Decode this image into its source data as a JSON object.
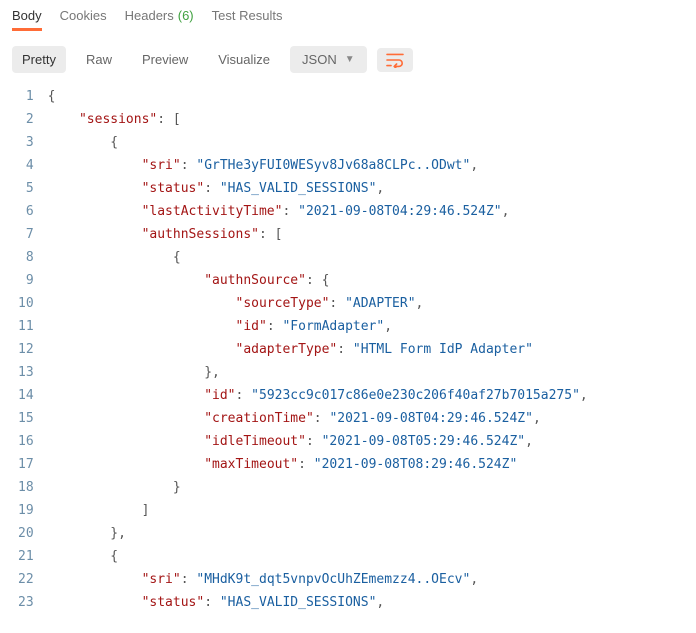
{
  "tabs": {
    "body": "Body",
    "cookies": "Cookies",
    "headers_label": "Headers",
    "headers_count": "(6)",
    "test_results": "Test Results"
  },
  "toolbar": {
    "pretty": "Pretty",
    "raw": "Raw",
    "preview": "Preview",
    "visualize": "Visualize",
    "format_label": "JSON"
  },
  "code": {
    "total_lines": 23,
    "lines": [
      {
        "indent": 0,
        "tokens": [
          {
            "t": "{",
            "c": "punc"
          }
        ]
      },
      {
        "indent": 1,
        "tokens": [
          {
            "t": "\"sessions\"",
            "c": "key"
          },
          {
            "t": ": [",
            "c": "punc"
          }
        ]
      },
      {
        "indent": 2,
        "tokens": [
          {
            "t": "{",
            "c": "punc"
          }
        ]
      },
      {
        "indent": 3,
        "tokens": [
          {
            "t": "\"sri\"",
            "c": "key"
          },
          {
            "t": ": ",
            "c": "punc"
          },
          {
            "t": "\"GrTHe3yFUI0WESyv8Jv68a8CLPc..ODwt\"",
            "c": "str"
          },
          {
            "t": ",",
            "c": "punc"
          }
        ]
      },
      {
        "indent": 3,
        "tokens": [
          {
            "t": "\"status\"",
            "c": "key"
          },
          {
            "t": ": ",
            "c": "punc"
          },
          {
            "t": "\"HAS_VALID_SESSIONS\"",
            "c": "str"
          },
          {
            "t": ",",
            "c": "punc"
          }
        ]
      },
      {
        "indent": 3,
        "tokens": [
          {
            "t": "\"lastActivityTime\"",
            "c": "key"
          },
          {
            "t": ": ",
            "c": "punc"
          },
          {
            "t": "\"2021-09-08T04:29:46.524Z\"",
            "c": "str"
          },
          {
            "t": ",",
            "c": "punc"
          }
        ]
      },
      {
        "indent": 3,
        "tokens": [
          {
            "t": "\"authnSessions\"",
            "c": "key"
          },
          {
            "t": ": [",
            "c": "punc"
          }
        ]
      },
      {
        "indent": 4,
        "tokens": [
          {
            "t": "{",
            "c": "punc"
          }
        ]
      },
      {
        "indent": 5,
        "tokens": [
          {
            "t": "\"authnSource\"",
            "c": "key"
          },
          {
            "t": ": {",
            "c": "punc"
          }
        ]
      },
      {
        "indent": 6,
        "tokens": [
          {
            "t": "\"sourceType\"",
            "c": "key"
          },
          {
            "t": ": ",
            "c": "punc"
          },
          {
            "t": "\"ADAPTER\"",
            "c": "str"
          },
          {
            "t": ",",
            "c": "punc"
          }
        ]
      },
      {
        "indent": 6,
        "tokens": [
          {
            "t": "\"id\"",
            "c": "key"
          },
          {
            "t": ": ",
            "c": "punc"
          },
          {
            "t": "\"FormAdapter\"",
            "c": "str"
          },
          {
            "t": ",",
            "c": "punc"
          }
        ]
      },
      {
        "indent": 6,
        "tokens": [
          {
            "t": "\"adapterType\"",
            "c": "key"
          },
          {
            "t": ": ",
            "c": "punc"
          },
          {
            "t": "\"HTML Form IdP Adapter\"",
            "c": "str"
          }
        ]
      },
      {
        "indent": 5,
        "tokens": [
          {
            "t": "},",
            "c": "punc"
          }
        ]
      },
      {
        "indent": 5,
        "tokens": [
          {
            "t": "\"id\"",
            "c": "key"
          },
          {
            "t": ": ",
            "c": "punc"
          },
          {
            "t": "\"5923cc9c017c86e0e230c206f40af27b7015a275\"",
            "c": "str"
          },
          {
            "t": ",",
            "c": "punc"
          }
        ]
      },
      {
        "indent": 5,
        "tokens": [
          {
            "t": "\"creationTime\"",
            "c": "key"
          },
          {
            "t": ": ",
            "c": "punc"
          },
          {
            "t": "\"2021-09-08T04:29:46.524Z\"",
            "c": "str"
          },
          {
            "t": ",",
            "c": "punc"
          }
        ]
      },
      {
        "indent": 5,
        "tokens": [
          {
            "t": "\"idleTimeout\"",
            "c": "key"
          },
          {
            "t": ": ",
            "c": "punc"
          },
          {
            "t": "\"2021-09-08T05:29:46.524Z\"",
            "c": "str"
          },
          {
            "t": ",",
            "c": "punc"
          }
        ]
      },
      {
        "indent": 5,
        "tokens": [
          {
            "t": "\"maxTimeout\"",
            "c": "key"
          },
          {
            "t": ": ",
            "c": "punc"
          },
          {
            "t": "\"2021-09-08T08:29:46.524Z\"",
            "c": "str"
          }
        ]
      },
      {
        "indent": 4,
        "tokens": [
          {
            "t": "}",
            "c": "punc"
          }
        ]
      },
      {
        "indent": 3,
        "tokens": [
          {
            "t": "]",
            "c": "punc"
          }
        ]
      },
      {
        "indent": 2,
        "tokens": [
          {
            "t": "},",
            "c": "punc"
          }
        ]
      },
      {
        "indent": 2,
        "tokens": [
          {
            "t": "{",
            "c": "punc"
          }
        ]
      },
      {
        "indent": 3,
        "tokens": [
          {
            "t": "\"sri\"",
            "c": "key"
          },
          {
            "t": ": ",
            "c": "punc"
          },
          {
            "t": "\"MHdK9t_dqt5vnpvOcUhZEmemzz4..OEcv\"",
            "c": "str"
          },
          {
            "t": ",",
            "c": "punc"
          }
        ]
      },
      {
        "indent": 3,
        "tokens": [
          {
            "t": "\"status\"",
            "c": "key"
          },
          {
            "t": ": ",
            "c": "punc"
          },
          {
            "t": "\"HAS_VALID_SESSIONS\"",
            "c": "str"
          },
          {
            "t": ",",
            "c": "punc"
          }
        ]
      }
    ]
  }
}
